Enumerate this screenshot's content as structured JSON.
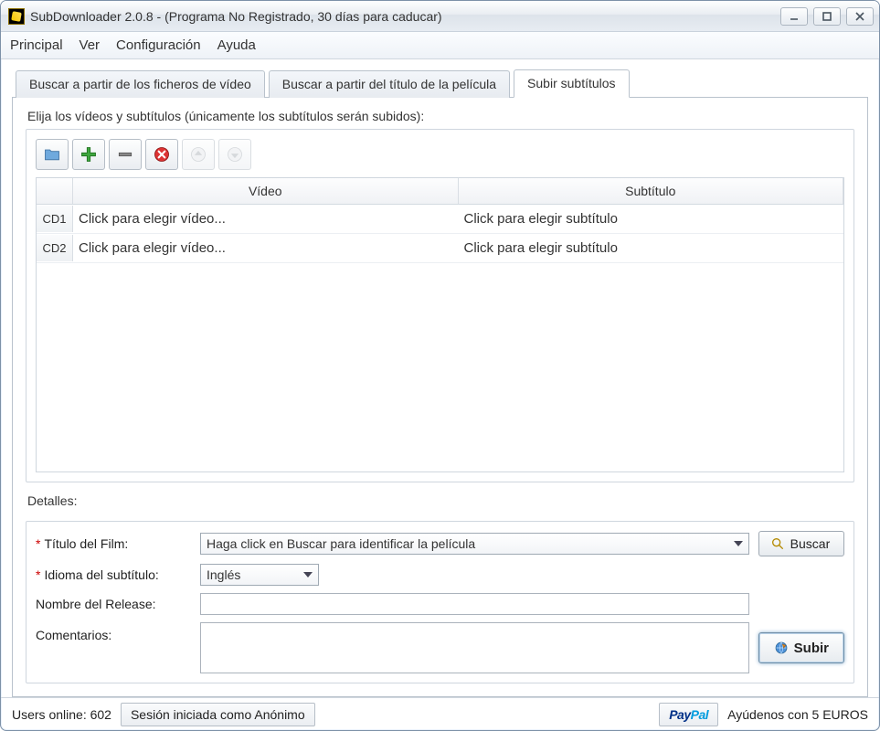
{
  "window": {
    "title": "SubDownloader 2.0.8 - (Programa No Registrado, 30 días para caducar)"
  },
  "menu": {
    "principal": "Principal",
    "ver": "Ver",
    "configuracion": "Configuración",
    "ayuda": "Ayuda"
  },
  "tabs": {
    "tab1": "Buscar a partir de los ficheros de vídeo",
    "tab2": "Buscar a partir del título de la película",
    "tab3": "Subir subtítulos"
  },
  "upload": {
    "instruction": "Elija los vídeos y subtítulos (únicamente los subtítulos serán subidos):",
    "columns": {
      "video": "Vídeo",
      "subtitle": "Subtítulo"
    },
    "rows": [
      {
        "cd": "CD1",
        "video": "Click para elegir vídeo...",
        "subtitle": "Click para elegir subtítulo"
      },
      {
        "cd": "CD2",
        "video": "Click para elegir vídeo...",
        "subtitle": "Click para elegir subtítulo"
      }
    ]
  },
  "details": {
    "heading": "Detalles:",
    "film_label": "Título del Film:",
    "film_value": "Haga click en Buscar para identificar la película",
    "search_btn": "Buscar",
    "lang_label": "Idioma del subtítulo:",
    "lang_value": "Inglés",
    "release_label": "Nombre del Release:",
    "comments_label": "Comentarios:",
    "upload_btn": "Subir"
  },
  "status": {
    "users_label": "Users online:",
    "users_value": "602",
    "session": "Sesión iniciada como Anónimo",
    "donate": "Ayúdenos con 5 EUROS"
  }
}
